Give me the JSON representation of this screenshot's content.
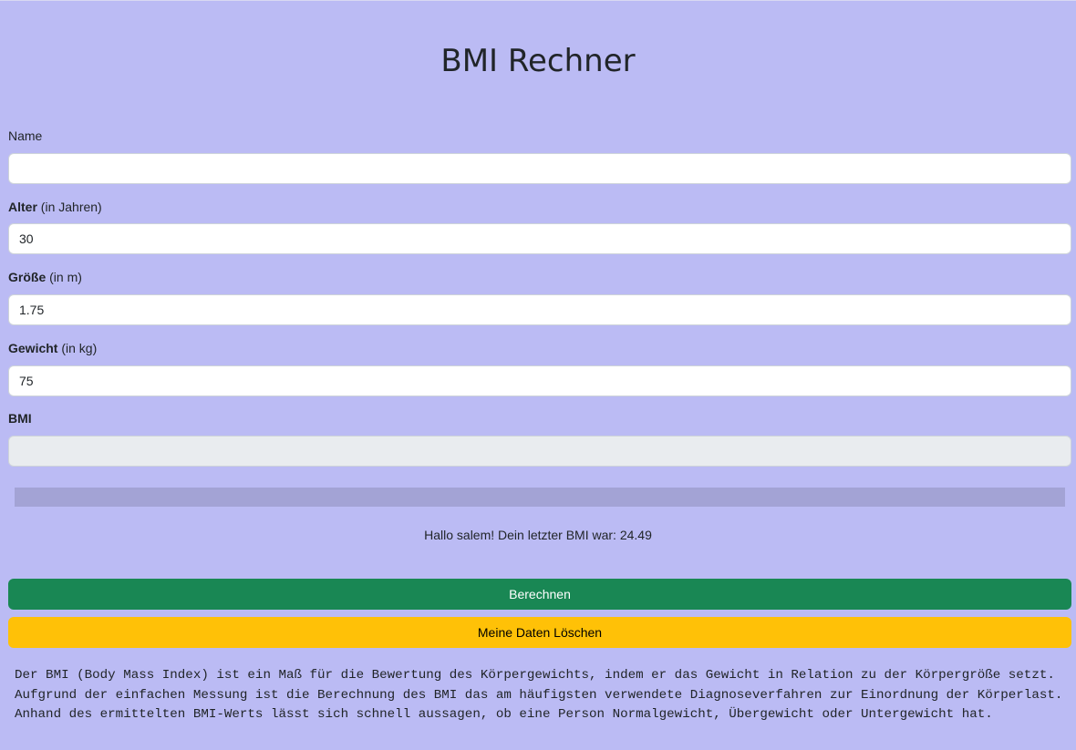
{
  "title": "BMI Rechner",
  "fields": {
    "name": {
      "label": "Name",
      "value": ""
    },
    "alter": {
      "label_bold": "Alter",
      "label_suffix": " (in Jahren)",
      "value": "30"
    },
    "groesse": {
      "label_bold": "Größe",
      "label_suffix": " (in m)",
      "value": "1.75"
    },
    "gewicht": {
      "label_bold": "Gewicht",
      "label_suffix": " (in kg)",
      "value": "75"
    },
    "bmi": {
      "label_bold": "BMI",
      "value": ""
    }
  },
  "progress": {
    "fraction": 0
  },
  "greeting": "Hallo salem! Dein letzter BMI war: 24.49",
  "buttons": {
    "calculate": "Berechnen",
    "delete": "Meine Daten Löschen"
  },
  "info_text": "Der BMI (Body Mass Index) ist ein Maß für die Bewertung des Körpergewichts, indem er das Gewicht in Relation zu der Körpergröße setzt. Aufgrund der einfachen Messung ist die Berechnung des BMI das am häufigsten verwendete Diagnoseverfahren zur Einordnung der Körperlast. Anhand des ermittelten BMI-Werts lässt sich schnell aussagen, ob eine Person Normalgewicht, Übergewicht oder Untergewicht hat.",
  "colors": {
    "background": "#bbbbf4",
    "calculate_button": "#198754",
    "delete_button": "#ffc107"
  }
}
